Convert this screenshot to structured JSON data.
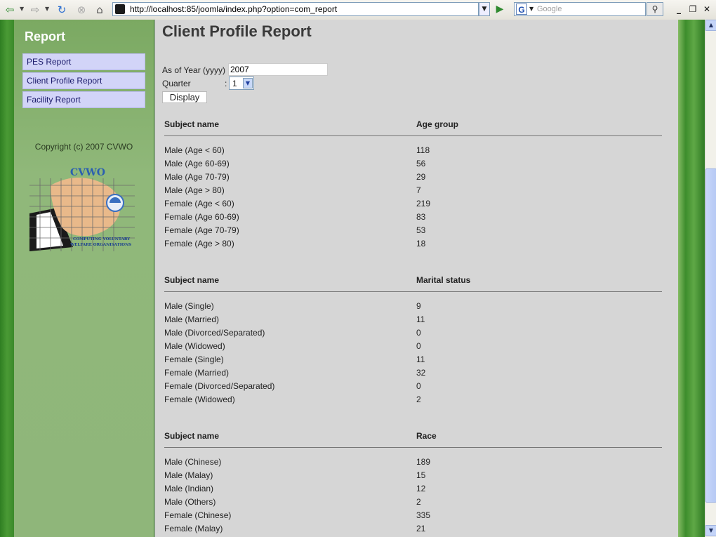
{
  "browser": {
    "url": "http://localhost:85/joomla/index.php?option=com_report",
    "search_placeholder": "Google"
  },
  "sidebar": {
    "title": "Report",
    "items": [
      {
        "label": "PES Report"
      },
      {
        "label": "Client Profile Report"
      },
      {
        "label": "Facility Report"
      }
    ],
    "copyright": "Copyright (c) 2007 CVWO",
    "logo_text_top": "CVWO",
    "logo_text_bottom_1": "COMPUTING VOLUNTARY",
    "logo_text_bottom_2": "WELFARE ORGANISATIONS"
  },
  "page": {
    "title": "Client Profile Report",
    "year_label": "As of Year (yyyy) :",
    "year_value": "2007",
    "quarter_label": "Quarter",
    "quarter_colon": ":",
    "quarter_value": "1",
    "display_button": "Display"
  },
  "sections": [
    {
      "col1": "Subject name",
      "col2": "Age group",
      "rows": [
        {
          "label": "Male (Age < 60)",
          "value": "118"
        },
        {
          "label": "Male (Age 60-69)",
          "value": "56"
        },
        {
          "label": "Male (Age 70-79)",
          "value": "29"
        },
        {
          "label": "Male (Age > 80)",
          "value": "7"
        },
        {
          "label": "Female (Age < 60)",
          "value": "219"
        },
        {
          "label": "Female (Age 60-69)",
          "value": "83"
        },
        {
          "label": "Female (Age 70-79)",
          "value": "53"
        },
        {
          "label": "Female (Age > 80)",
          "value": "18"
        }
      ]
    },
    {
      "col1": "Subject name",
      "col2": "Marital status",
      "rows": [
        {
          "label": "Male (Single)",
          "value": "9"
        },
        {
          "label": "Male (Married)",
          "value": "11"
        },
        {
          "label": "Male (Divorced/Separated)",
          "value": "0"
        },
        {
          "label": "Male (Widowed)",
          "value": "0"
        },
        {
          "label": "Female (Single)",
          "value": "11"
        },
        {
          "label": "Female (Married)",
          "value": "32"
        },
        {
          "label": "Female (Divorced/Separated)",
          "value": "0"
        },
        {
          "label": "Female (Widowed)",
          "value": "2"
        }
      ]
    },
    {
      "col1": "Subject name",
      "col2": "Race",
      "rows": [
        {
          "label": "Male (Chinese)",
          "value": "189"
        },
        {
          "label": "Male (Malay)",
          "value": "15"
        },
        {
          "label": "Male (Indian)",
          "value": "12"
        },
        {
          "label": "Male (Others)",
          "value": "2"
        },
        {
          "label": "Female (Chinese)",
          "value": "335"
        },
        {
          "label": "Female (Malay)",
          "value": "21"
        }
      ]
    }
  ]
}
